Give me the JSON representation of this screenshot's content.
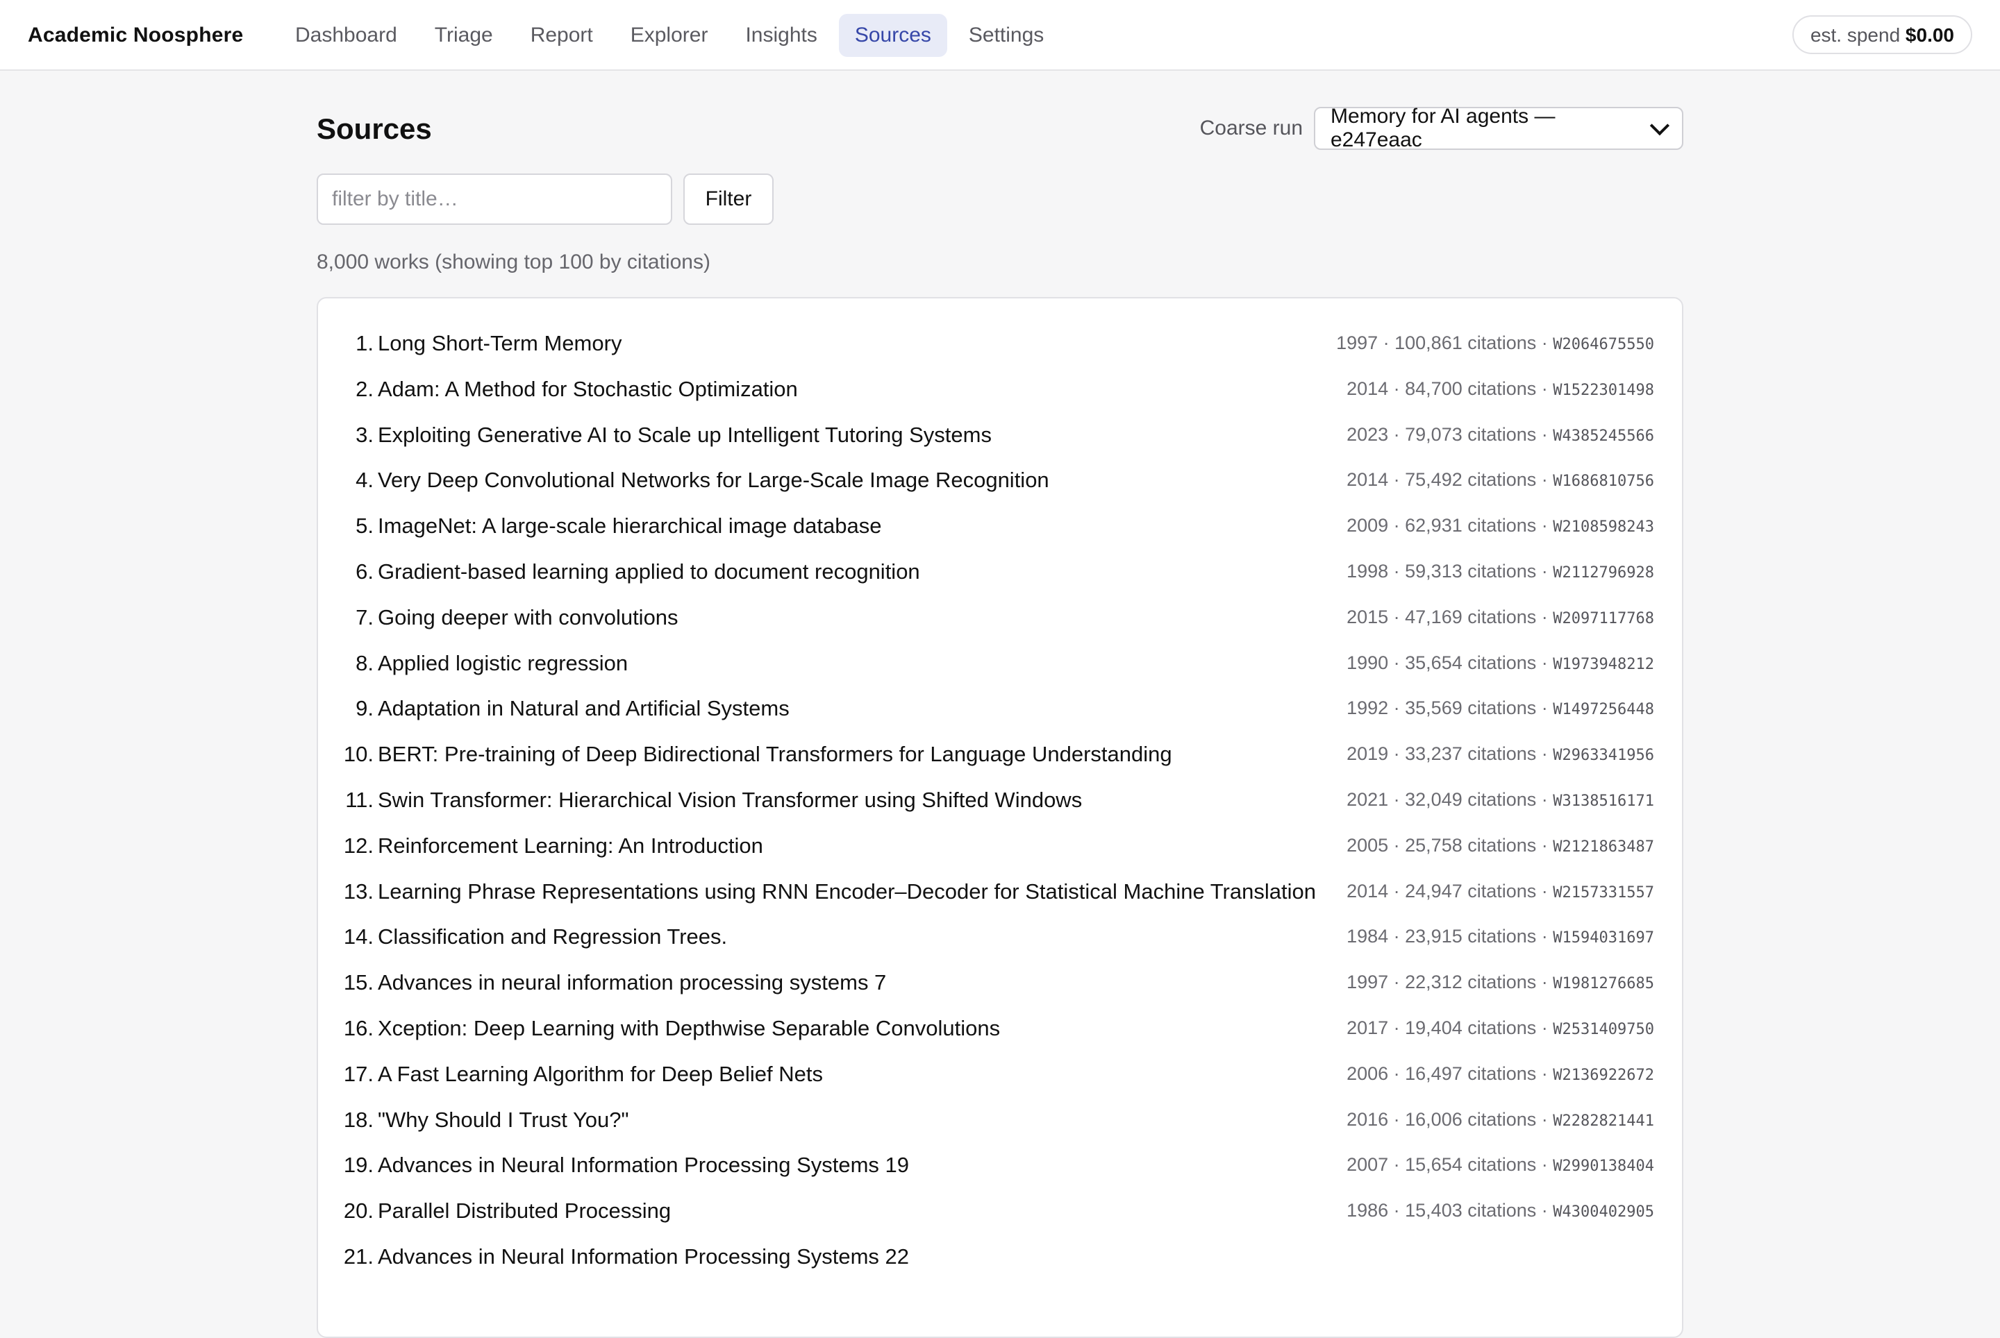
{
  "app": {
    "brand": "Academic Noosphere",
    "nav": [
      {
        "label": "Dashboard",
        "active": false
      },
      {
        "label": "Triage",
        "active": false
      },
      {
        "label": "Report",
        "active": false
      },
      {
        "label": "Explorer",
        "active": false
      },
      {
        "label": "Insights",
        "active": false
      },
      {
        "label": "Sources",
        "active": true
      },
      {
        "label": "Settings",
        "active": false
      }
    ],
    "spend_label": "est. spend",
    "spend_value": "$0.00"
  },
  "page": {
    "title": "Sources",
    "run_label": "Coarse run",
    "run_selected": "Memory for AI agents — e247eaac",
    "filter_placeholder": "filter by title…",
    "filter_button": "Filter",
    "summary": "8,000 works (showing top 100 by citations)"
  },
  "works": [
    {
      "num": "1.",
      "title": "Long Short-Term Memory",
      "meta": "1997 · 100,861 citations ·",
      "id": "W2064675550"
    },
    {
      "num": "2.",
      "title": "Adam: A Method for Stochastic Optimization",
      "meta": "2014 · 84,700 citations ·",
      "id": "W1522301498"
    },
    {
      "num": "3.",
      "title": "Exploiting Generative AI to Scale up Intelligent Tutoring Systems",
      "meta": "2023 · 79,073 citations ·",
      "id": "W4385245566"
    },
    {
      "num": "4.",
      "title": "Very Deep Convolutional Networks for Large-Scale Image Recognition",
      "meta": "2014 · 75,492 citations ·",
      "id": "W1686810756"
    },
    {
      "num": "5.",
      "title": "ImageNet: A large-scale hierarchical image database",
      "meta": "2009 · 62,931 citations ·",
      "id": "W2108598243"
    },
    {
      "num": "6.",
      "title": "Gradient-based learning applied to document recognition",
      "meta": "1998 · 59,313 citations ·",
      "id": "W2112796928"
    },
    {
      "num": "7.",
      "title": "Going deeper with convolutions",
      "meta": "2015 · 47,169 citations ·",
      "id": "W2097117768"
    },
    {
      "num": "8.",
      "title": "Applied logistic regression",
      "meta": "1990 · 35,654 citations ·",
      "id": "W1973948212"
    },
    {
      "num": "9.",
      "title": "Adaptation in Natural and Artificial Systems",
      "meta": "1992 · 35,569 citations ·",
      "id": "W1497256448"
    },
    {
      "num": "10.",
      "title": "BERT: Pre-training of Deep Bidirectional Transformers for Language Understanding",
      "meta": "2019 · 33,237 citations ·",
      "id": "W2963341956"
    },
    {
      "num": "11.",
      "title": "Swin Transformer: Hierarchical Vision Transformer using Shifted Windows",
      "meta": "2021 · 32,049 citations ·",
      "id": "W3138516171"
    },
    {
      "num": "12.",
      "title": "Reinforcement Learning: An Introduction",
      "meta": "2005 · 25,758 citations ·",
      "id": "W2121863487"
    },
    {
      "num": "13.",
      "title": "Learning Phrase Representations using RNN Encoder–Decoder for Statistical Machine Translation",
      "meta": "2014 · 24,947 citations ·",
      "id": "W2157331557"
    },
    {
      "num": "14.",
      "title": "Classification and Regression Trees.",
      "meta": "1984 · 23,915 citations ·",
      "id": "W1594031697"
    },
    {
      "num": "15.",
      "title": "Advances in neural information processing systems 7",
      "meta": "1997 · 22,312 citations ·",
      "id": "W1981276685"
    },
    {
      "num": "16.",
      "title": "Xception: Deep Learning with Depthwise Separable Convolutions",
      "meta": "2017 · 19,404 citations ·",
      "id": "W2531409750"
    },
    {
      "num": "17.",
      "title": "A Fast Learning Algorithm for Deep Belief Nets",
      "meta": "2006 · 16,497 citations ·",
      "id": "W2136922672"
    },
    {
      "num": "18.",
      "title": "\"Why Should I Trust You?\"",
      "meta": "2016 · 16,006 citations ·",
      "id": "W2282821441"
    },
    {
      "num": "19.",
      "title": "Advances in Neural Information Processing Systems 19",
      "meta": "2007 · 15,654 citations ·",
      "id": "W2990138404"
    },
    {
      "num": "20.",
      "title": "Parallel Distributed Processing",
      "meta": "1986 · 15,403 citations ·",
      "id": "W4300402905"
    },
    {
      "num": "21.",
      "title": "Advances in Neural Information Processing Systems 22",
      "meta": "",
      "id": ""
    }
  ]
}
